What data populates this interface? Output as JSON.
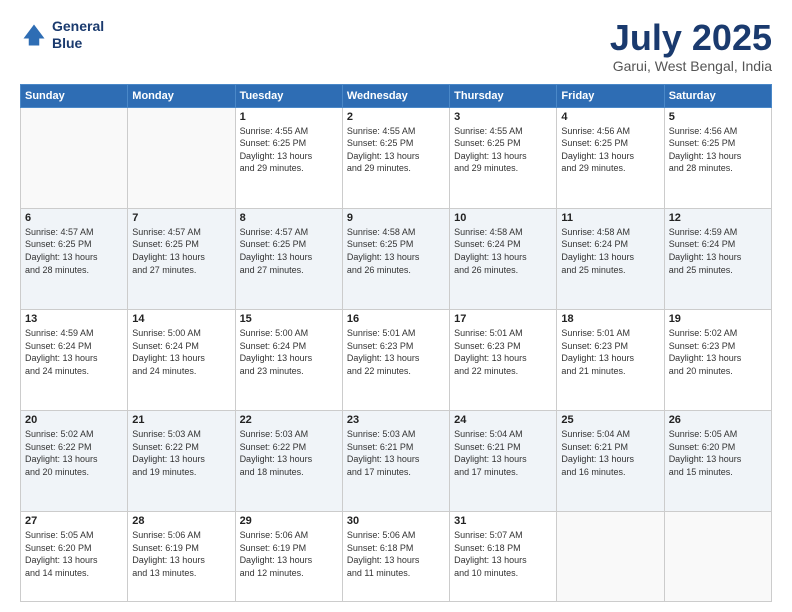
{
  "header": {
    "logo_line1": "General",
    "logo_line2": "Blue",
    "title": "July 2025",
    "subtitle": "Garui, West Bengal, India"
  },
  "columns": [
    "Sunday",
    "Monday",
    "Tuesday",
    "Wednesday",
    "Thursday",
    "Friday",
    "Saturday"
  ],
  "weeks": [
    {
      "cells": [
        {
          "day": "",
          "content": ""
        },
        {
          "day": "",
          "content": ""
        },
        {
          "day": "1",
          "content": "Sunrise: 4:55 AM\nSunset: 6:25 PM\nDaylight: 13 hours\nand 29 minutes."
        },
        {
          "day": "2",
          "content": "Sunrise: 4:55 AM\nSunset: 6:25 PM\nDaylight: 13 hours\nand 29 minutes."
        },
        {
          "day": "3",
          "content": "Sunrise: 4:55 AM\nSunset: 6:25 PM\nDaylight: 13 hours\nand 29 minutes."
        },
        {
          "day": "4",
          "content": "Sunrise: 4:56 AM\nSunset: 6:25 PM\nDaylight: 13 hours\nand 29 minutes."
        },
        {
          "day": "5",
          "content": "Sunrise: 4:56 AM\nSunset: 6:25 PM\nDaylight: 13 hours\nand 28 minutes."
        }
      ]
    },
    {
      "cells": [
        {
          "day": "6",
          "content": "Sunrise: 4:57 AM\nSunset: 6:25 PM\nDaylight: 13 hours\nand 28 minutes."
        },
        {
          "day": "7",
          "content": "Sunrise: 4:57 AM\nSunset: 6:25 PM\nDaylight: 13 hours\nand 27 minutes."
        },
        {
          "day": "8",
          "content": "Sunrise: 4:57 AM\nSunset: 6:25 PM\nDaylight: 13 hours\nand 27 minutes."
        },
        {
          "day": "9",
          "content": "Sunrise: 4:58 AM\nSunset: 6:25 PM\nDaylight: 13 hours\nand 26 minutes."
        },
        {
          "day": "10",
          "content": "Sunrise: 4:58 AM\nSunset: 6:24 PM\nDaylight: 13 hours\nand 26 minutes."
        },
        {
          "day": "11",
          "content": "Sunrise: 4:58 AM\nSunset: 6:24 PM\nDaylight: 13 hours\nand 25 minutes."
        },
        {
          "day": "12",
          "content": "Sunrise: 4:59 AM\nSunset: 6:24 PM\nDaylight: 13 hours\nand 25 minutes."
        }
      ]
    },
    {
      "cells": [
        {
          "day": "13",
          "content": "Sunrise: 4:59 AM\nSunset: 6:24 PM\nDaylight: 13 hours\nand 24 minutes."
        },
        {
          "day": "14",
          "content": "Sunrise: 5:00 AM\nSunset: 6:24 PM\nDaylight: 13 hours\nand 24 minutes."
        },
        {
          "day": "15",
          "content": "Sunrise: 5:00 AM\nSunset: 6:24 PM\nDaylight: 13 hours\nand 23 minutes."
        },
        {
          "day": "16",
          "content": "Sunrise: 5:01 AM\nSunset: 6:23 PM\nDaylight: 13 hours\nand 22 minutes."
        },
        {
          "day": "17",
          "content": "Sunrise: 5:01 AM\nSunset: 6:23 PM\nDaylight: 13 hours\nand 22 minutes."
        },
        {
          "day": "18",
          "content": "Sunrise: 5:01 AM\nSunset: 6:23 PM\nDaylight: 13 hours\nand 21 minutes."
        },
        {
          "day": "19",
          "content": "Sunrise: 5:02 AM\nSunset: 6:23 PM\nDaylight: 13 hours\nand 20 minutes."
        }
      ]
    },
    {
      "cells": [
        {
          "day": "20",
          "content": "Sunrise: 5:02 AM\nSunset: 6:22 PM\nDaylight: 13 hours\nand 20 minutes."
        },
        {
          "day": "21",
          "content": "Sunrise: 5:03 AM\nSunset: 6:22 PM\nDaylight: 13 hours\nand 19 minutes."
        },
        {
          "day": "22",
          "content": "Sunrise: 5:03 AM\nSunset: 6:22 PM\nDaylight: 13 hours\nand 18 minutes."
        },
        {
          "day": "23",
          "content": "Sunrise: 5:03 AM\nSunset: 6:21 PM\nDaylight: 13 hours\nand 17 minutes."
        },
        {
          "day": "24",
          "content": "Sunrise: 5:04 AM\nSunset: 6:21 PM\nDaylight: 13 hours\nand 17 minutes."
        },
        {
          "day": "25",
          "content": "Sunrise: 5:04 AM\nSunset: 6:21 PM\nDaylight: 13 hours\nand 16 minutes."
        },
        {
          "day": "26",
          "content": "Sunrise: 5:05 AM\nSunset: 6:20 PM\nDaylight: 13 hours\nand 15 minutes."
        }
      ]
    },
    {
      "cells": [
        {
          "day": "27",
          "content": "Sunrise: 5:05 AM\nSunset: 6:20 PM\nDaylight: 13 hours\nand 14 minutes."
        },
        {
          "day": "28",
          "content": "Sunrise: 5:06 AM\nSunset: 6:19 PM\nDaylight: 13 hours\nand 13 minutes."
        },
        {
          "day": "29",
          "content": "Sunrise: 5:06 AM\nSunset: 6:19 PM\nDaylight: 13 hours\nand 12 minutes."
        },
        {
          "day": "30",
          "content": "Sunrise: 5:06 AM\nSunset: 6:18 PM\nDaylight: 13 hours\nand 11 minutes."
        },
        {
          "day": "31",
          "content": "Sunrise: 5:07 AM\nSunset: 6:18 PM\nDaylight: 13 hours\nand 10 minutes."
        },
        {
          "day": "",
          "content": ""
        },
        {
          "day": "",
          "content": ""
        }
      ]
    }
  ]
}
